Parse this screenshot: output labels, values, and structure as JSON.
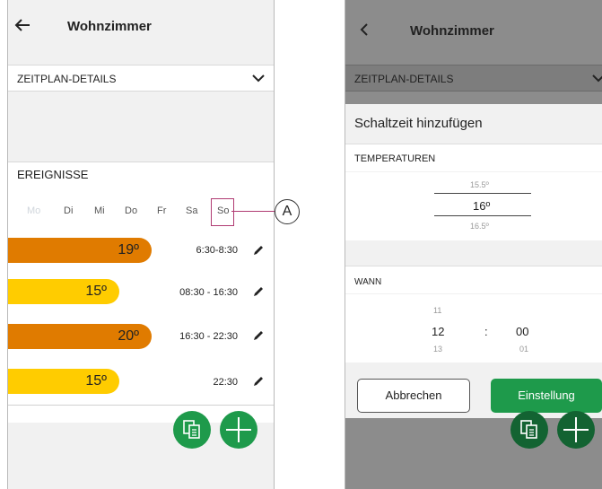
{
  "left": {
    "header": {
      "title": "Wohnzimmer",
      "back_icon": "arrow-left-icon"
    },
    "details_label": "ZEITPLAN-DETAILS",
    "events_label": "EREIGNISSE",
    "days": [
      "Mo",
      "Di",
      "Mi",
      "Do",
      "Fr",
      "Sa",
      "So"
    ],
    "callout": "A",
    "events": [
      {
        "temp": "19º",
        "time": "6:30-8:30",
        "color": "#e07b00"
      },
      {
        "temp": "15º",
        "time": "08:30 - 16:30",
        "color": "#ffcc00"
      },
      {
        "temp": "20º",
        "time": "16:30 - 22:30",
        "color": "#e07b00"
      },
      {
        "temp": "15º",
        "time": "22:30",
        "color": "#ffcc00"
      }
    ]
  },
  "right": {
    "header": {
      "title": "Wohnzimmer",
      "back_icon": "chevron-left-icon"
    },
    "details_label": "ZEITPLAN-DETAILS",
    "dialog": {
      "title": "Schaltzeit hinzufügen",
      "temperatures_label": "TEMPERATUREN",
      "temp_above": "15.5º",
      "temp_selected": "16º",
      "temp_below": "16.5º",
      "when_label": "WANN",
      "hour_above": "11",
      "hour_selected": "12",
      "separator": ":",
      "minute_selected": "00",
      "hour_below": "13",
      "minute_below": "01",
      "cancel_label": "Abbrechen",
      "confirm_label": "Einstellung"
    }
  },
  "colors": {
    "green": "#1e9a4b",
    "orange": "#e07b00",
    "yellow": "#ffcc00"
  }
}
